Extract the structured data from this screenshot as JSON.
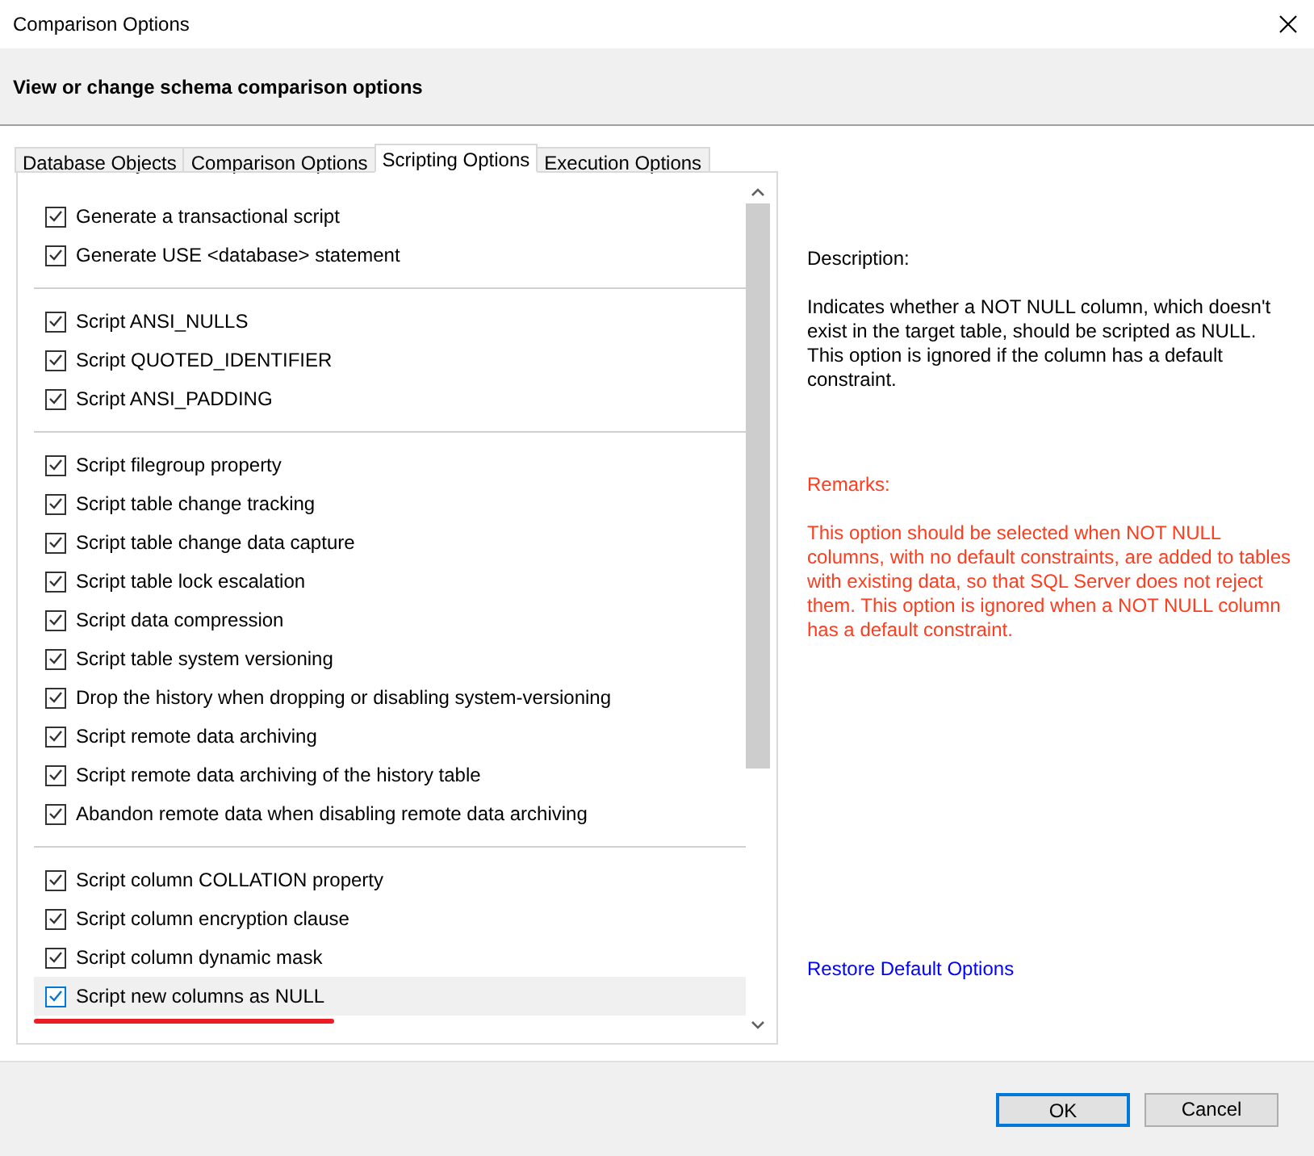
{
  "window": {
    "title": "Comparison Options"
  },
  "header": "View or change schema comparison options",
  "tabs": [
    {
      "label": "Database Objects",
      "selected": false
    },
    {
      "label": "Comparison Options",
      "selected": false
    },
    {
      "label": "Scripting Options",
      "selected": true
    },
    {
      "label": "Execution Options",
      "selected": false
    }
  ],
  "option_groups": [
    {
      "options": [
        {
          "label": "Generate a transactional script",
          "checked": true,
          "selected": false,
          "underlined": false
        },
        {
          "label": "Generate USE <database> statement",
          "checked": true,
          "selected": false,
          "underlined": false
        }
      ]
    },
    {
      "options": [
        {
          "label": "Script ANSI_NULLS",
          "checked": true,
          "selected": false,
          "underlined": false
        },
        {
          "label": "Script QUOTED_IDENTIFIER",
          "checked": true,
          "selected": false,
          "underlined": false
        },
        {
          "label": "Script ANSI_PADDING",
          "checked": true,
          "selected": false,
          "underlined": false
        }
      ]
    },
    {
      "options": [
        {
          "label": "Script filegroup property",
          "checked": true,
          "selected": false,
          "underlined": false
        },
        {
          "label": "Script table change tracking",
          "checked": true,
          "selected": false,
          "underlined": false
        },
        {
          "label": "Script table change data capture",
          "checked": true,
          "selected": false,
          "underlined": false
        },
        {
          "label": "Script table lock escalation",
          "checked": true,
          "selected": false,
          "underlined": false
        },
        {
          "label": "Script data compression",
          "checked": true,
          "selected": false,
          "underlined": false
        },
        {
          "label": "Script table system versioning",
          "checked": true,
          "selected": false,
          "underlined": false
        },
        {
          "label": "Drop the history when dropping or disabling system-versioning",
          "checked": true,
          "selected": false,
          "underlined": false
        },
        {
          "label": "Script remote data archiving",
          "checked": true,
          "selected": false,
          "underlined": false
        },
        {
          "label": "Script remote data archiving of the history table",
          "checked": true,
          "selected": false,
          "underlined": false
        },
        {
          "label": "Abandon remote data when disabling remote data archiving",
          "checked": true,
          "selected": false,
          "underlined": false
        }
      ]
    },
    {
      "options": [
        {
          "label": "Script column COLLATION property",
          "checked": true,
          "selected": false,
          "underlined": false
        },
        {
          "label": "Script column encryption clause",
          "checked": true,
          "selected": false,
          "underlined": false
        },
        {
          "label": "Script column dynamic mask",
          "checked": true,
          "selected": false,
          "underlined": false
        },
        {
          "label": "Script new columns as NULL",
          "checked": true,
          "selected": true,
          "underlined": true
        }
      ]
    }
  ],
  "description": {
    "heading": "Description:",
    "text": "Indicates whether a NOT NULL column, which doesn't exist in the target table, should be scripted as NULL. This option is ignored if the column has a default constraint."
  },
  "remarks": {
    "heading": "Remarks:",
    "text": "This option should be selected when NOT NULL columns, with no default constraints, are added to tables with existing data, so that SQL Server does not reject them. This option is ignored when a NOT NULL column has a default constraint."
  },
  "restore_link": "Restore Default Options",
  "buttons": [
    {
      "label": "OK",
      "kind": "default"
    },
    {
      "label": "Cancel",
      "kind": "normal"
    }
  ]
}
